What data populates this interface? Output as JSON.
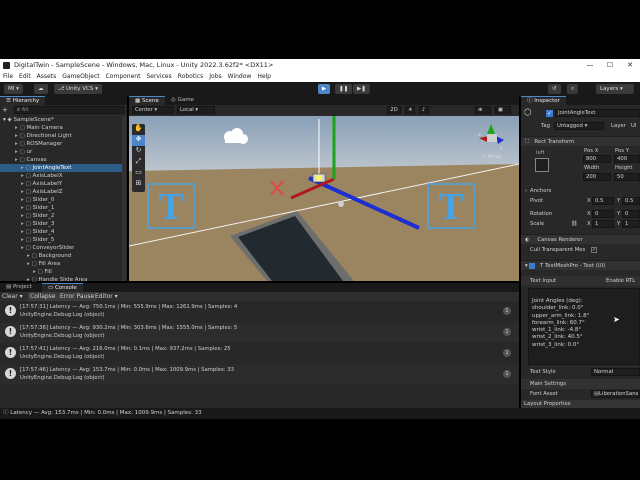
{
  "window": {
    "title": "DigitalTwin - SampleScene - Windows, Mac, Linux - Unity 2022.3.62f2* <DX11>",
    "minimize": "—",
    "maximize": "☐",
    "close": "✕"
  },
  "menu": [
    "File",
    "Edit",
    "Assets",
    "GameObject",
    "Component",
    "Services",
    "Robotics",
    "Jobs",
    "Window",
    "Help"
  ],
  "toolbar": {
    "account": "MI",
    "vcs": "Unity VCS",
    "layers": "Layers"
  },
  "hierarchy": {
    "tab": "Hierarchy",
    "search_placeholder": "All",
    "items": [
      {
        "label": "SampleScene*",
        "indent": 0
      },
      {
        "label": "Main Camera",
        "indent": 2
      },
      {
        "label": "Directional Light",
        "indent": 2
      },
      {
        "label": "ROSManager",
        "indent": 2
      },
      {
        "label": "ur",
        "indent": 2
      },
      {
        "label": "Canvas",
        "indent": 2
      },
      {
        "label": "JointAngleText",
        "indent": 3,
        "selected": true
      },
      {
        "label": "AxisLabelX",
        "indent": 3
      },
      {
        "label": "AxisLabelY",
        "indent": 3
      },
      {
        "label": "AxisLabelZ",
        "indent": 3
      },
      {
        "label": "Slider_0",
        "indent": 3
      },
      {
        "label": "Slider_1",
        "indent": 3
      },
      {
        "label": "Slider_2",
        "indent": 3
      },
      {
        "label": "Slider_3",
        "indent": 3
      },
      {
        "label": "Slider_4",
        "indent": 3
      },
      {
        "label": "Slider_5",
        "indent": 3
      },
      {
        "label": "ConveyorSlider",
        "indent": 3
      },
      {
        "label": "Background",
        "indent": 4
      },
      {
        "label": "Fill Area",
        "indent": 4
      },
      {
        "label": "Fill",
        "indent": 5
      },
      {
        "label": "Handle Slide Area",
        "indent": 4
      }
    ]
  },
  "scene": {
    "tab_scene": "Scene",
    "tab_game": "Game",
    "pivot": "Center",
    "space": "Local",
    "mode_2d": "2D",
    "persp": "< Persp",
    "axis_x": "x",
    "axis_z": "z"
  },
  "console": {
    "tab_project": "Project",
    "tab_console": "Console",
    "clear": "Clear",
    "collapse": "Collapse",
    "error_pause": "Error Pause",
    "editor": "Editor",
    "logs": [
      {
        "line1": "[17:57:31] Latency — Avg: 750.1ms | Min: 555.9ms | Max: 1261.9ms | Samples: 4",
        "line2": "UnityEngine.Debug:Log (object)",
        "count": "1"
      },
      {
        "line1": "[17:57:36] Latency — Avg: 930.2ms | Min: 303.6ms | Max: 1555.0ms | Samples: 5",
        "line2": "UnityEngine.Debug:Log (object)",
        "count": "1"
      },
      {
        "line1": "[17:57:41] Latency — Avg: 216.0ms | Min: 0.1ms | Max: 937.2ms | Samples: 25",
        "line2": "UnityEngine.Debug:Log (object)",
        "count": "1"
      },
      {
        "line1": "[17:57:46] Latency — Avg: 153.7ms | Min: 0.0ms | Max: 1009.9ms | Samples: 33",
        "line2": "UnityEngine.Debug:Log (object)",
        "count": "1"
      }
    ]
  },
  "status": "Latency — Avg: 153.7ms | Min: 0.0ms | Max: 1009.9ms | Samples: 33",
  "inspector": {
    "tab": "Inspector",
    "object_name": "JointAngleText",
    "tag_label": "Tag",
    "tag_value": "Untagged",
    "layer_label": "Layer",
    "layer_value": "UI",
    "rect_transform": "Rect Transform",
    "anchor_preset": "left",
    "pos_x_label": "Pos X",
    "pos_x": "800",
    "pos_y_label": "Pos Y",
    "pos_y": "400",
    "width_label": "Width",
    "width": "200",
    "height_label": "Height",
    "height": "50",
    "anchors": "Anchors",
    "pivot": "Pivot",
    "pivot_x": "0.5",
    "pivot_y": "0.5",
    "rotation": "Rotation",
    "rot_x": "0",
    "rot_y": "0",
    "scale": "Scale",
    "scale_x": "1",
    "scale_y": "1",
    "canvas_renderer": "Canvas Renderer",
    "cull_transparent": "Cull Transparent Mes",
    "tmp": "TextMeshPro - Text (UI)",
    "text_input": "Text Input",
    "enable_rtl": "Enable RTL",
    "text_lines": [
      "Joint Angles (deg):",
      "shoulder_link: 0.0°",
      "upper_arm_link: 1.8°",
      "forearm_link: 60.7°",
      "wrist_1_link: -4.8°",
      "wrist_2_link: 40.5°",
      "wrist_3_link: 0.0°"
    ],
    "text_style": "Text Style",
    "text_style_value": "Normal",
    "main_settings": "Main Settings",
    "font_asset": "Font Asset",
    "font_asset_value": "LiberationSans",
    "layout_props": "Layout Properties"
  },
  "colors": {
    "accent": "#4a86c8",
    "selection": "#2c5d87",
    "panel": "#282828",
    "dark": "#191919"
  }
}
